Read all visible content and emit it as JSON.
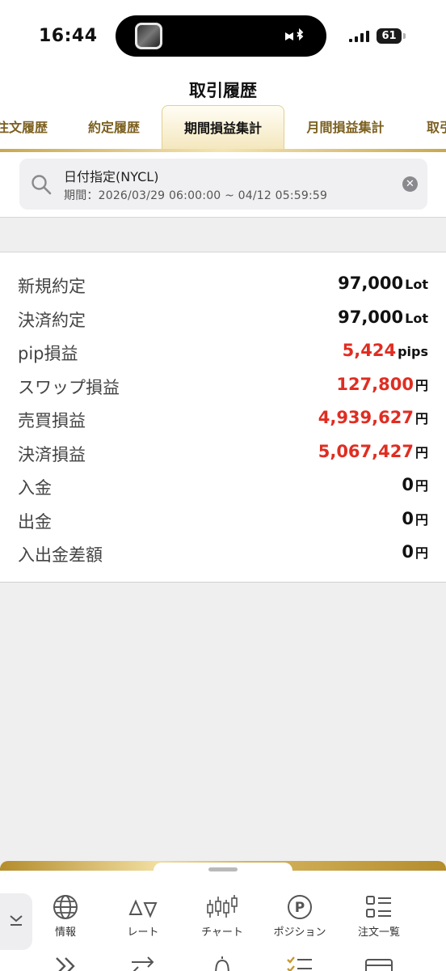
{
  "status_bar": {
    "time": "16:44",
    "battery": "61",
    "icons": [
      "app-thumbnail-icon",
      "bluetooth-icon",
      "signal-icon",
      "battery-icon"
    ]
  },
  "header": {
    "title": "取引履歴",
    "tabs": [
      {
        "label": "注文履歴",
        "active": false
      },
      {
        "label": "約定履歴",
        "active": false
      },
      {
        "label": "期間損益集計",
        "active": true
      },
      {
        "label": "月間損益集計",
        "active": false
      },
      {
        "label": "取引",
        "active": false
      }
    ]
  },
  "filter": {
    "title": "日付指定(NYCL)",
    "period": "期間：2026/03/29 06:00:00 ~ 04/12 05:59:59"
  },
  "summary": [
    {
      "label": "新規約定",
      "value": "97,000",
      "unit": "Lot",
      "color": "#111111"
    },
    {
      "label": "決済約定",
      "value": "97,000",
      "unit": "Lot",
      "color": "#111111"
    },
    {
      "label": "pip損益",
      "value": "5,424",
      "unit": "pips",
      "color": "#e02d22"
    },
    {
      "label": "スワップ損益",
      "value": "127,800",
      "unit": "円",
      "color": "#e02d22"
    },
    {
      "label": "売買損益",
      "value": "4,939,627",
      "unit": "円",
      "color": "#e02d22"
    },
    {
      "label": "決済損益",
      "value": "5,067,427",
      "unit": "円",
      "color": "#e02d22"
    },
    {
      "label": "入金",
      "value": "0",
      "unit": "円",
      "color": "#111111"
    },
    {
      "label": "出金",
      "value": "0",
      "unit": "円",
      "color": "#111111"
    },
    {
      "label": "入出金差額",
      "value": "0",
      "unit": "円",
      "color": "#111111"
    }
  ],
  "bottom_nav": {
    "items": [
      {
        "label": "情報",
        "icon": "globe-icon"
      },
      {
        "label": "レート",
        "icon": "rate-icon"
      },
      {
        "label": "チャート",
        "icon": "candlestick-chart-icon"
      },
      {
        "label": "ポジション",
        "icon": "position-p-icon"
      },
      {
        "label": "注文一覧",
        "icon": "order-list-icon"
      }
    ],
    "second_row_icons": [
      "double-chevron-right-icon",
      "swap-arrows-icon",
      "bell-icon",
      "checklist-icon",
      "card-icon"
    ]
  },
  "colors": {
    "gold_accent": "#b58f2a",
    "profit_red": "#e02d22"
  }
}
